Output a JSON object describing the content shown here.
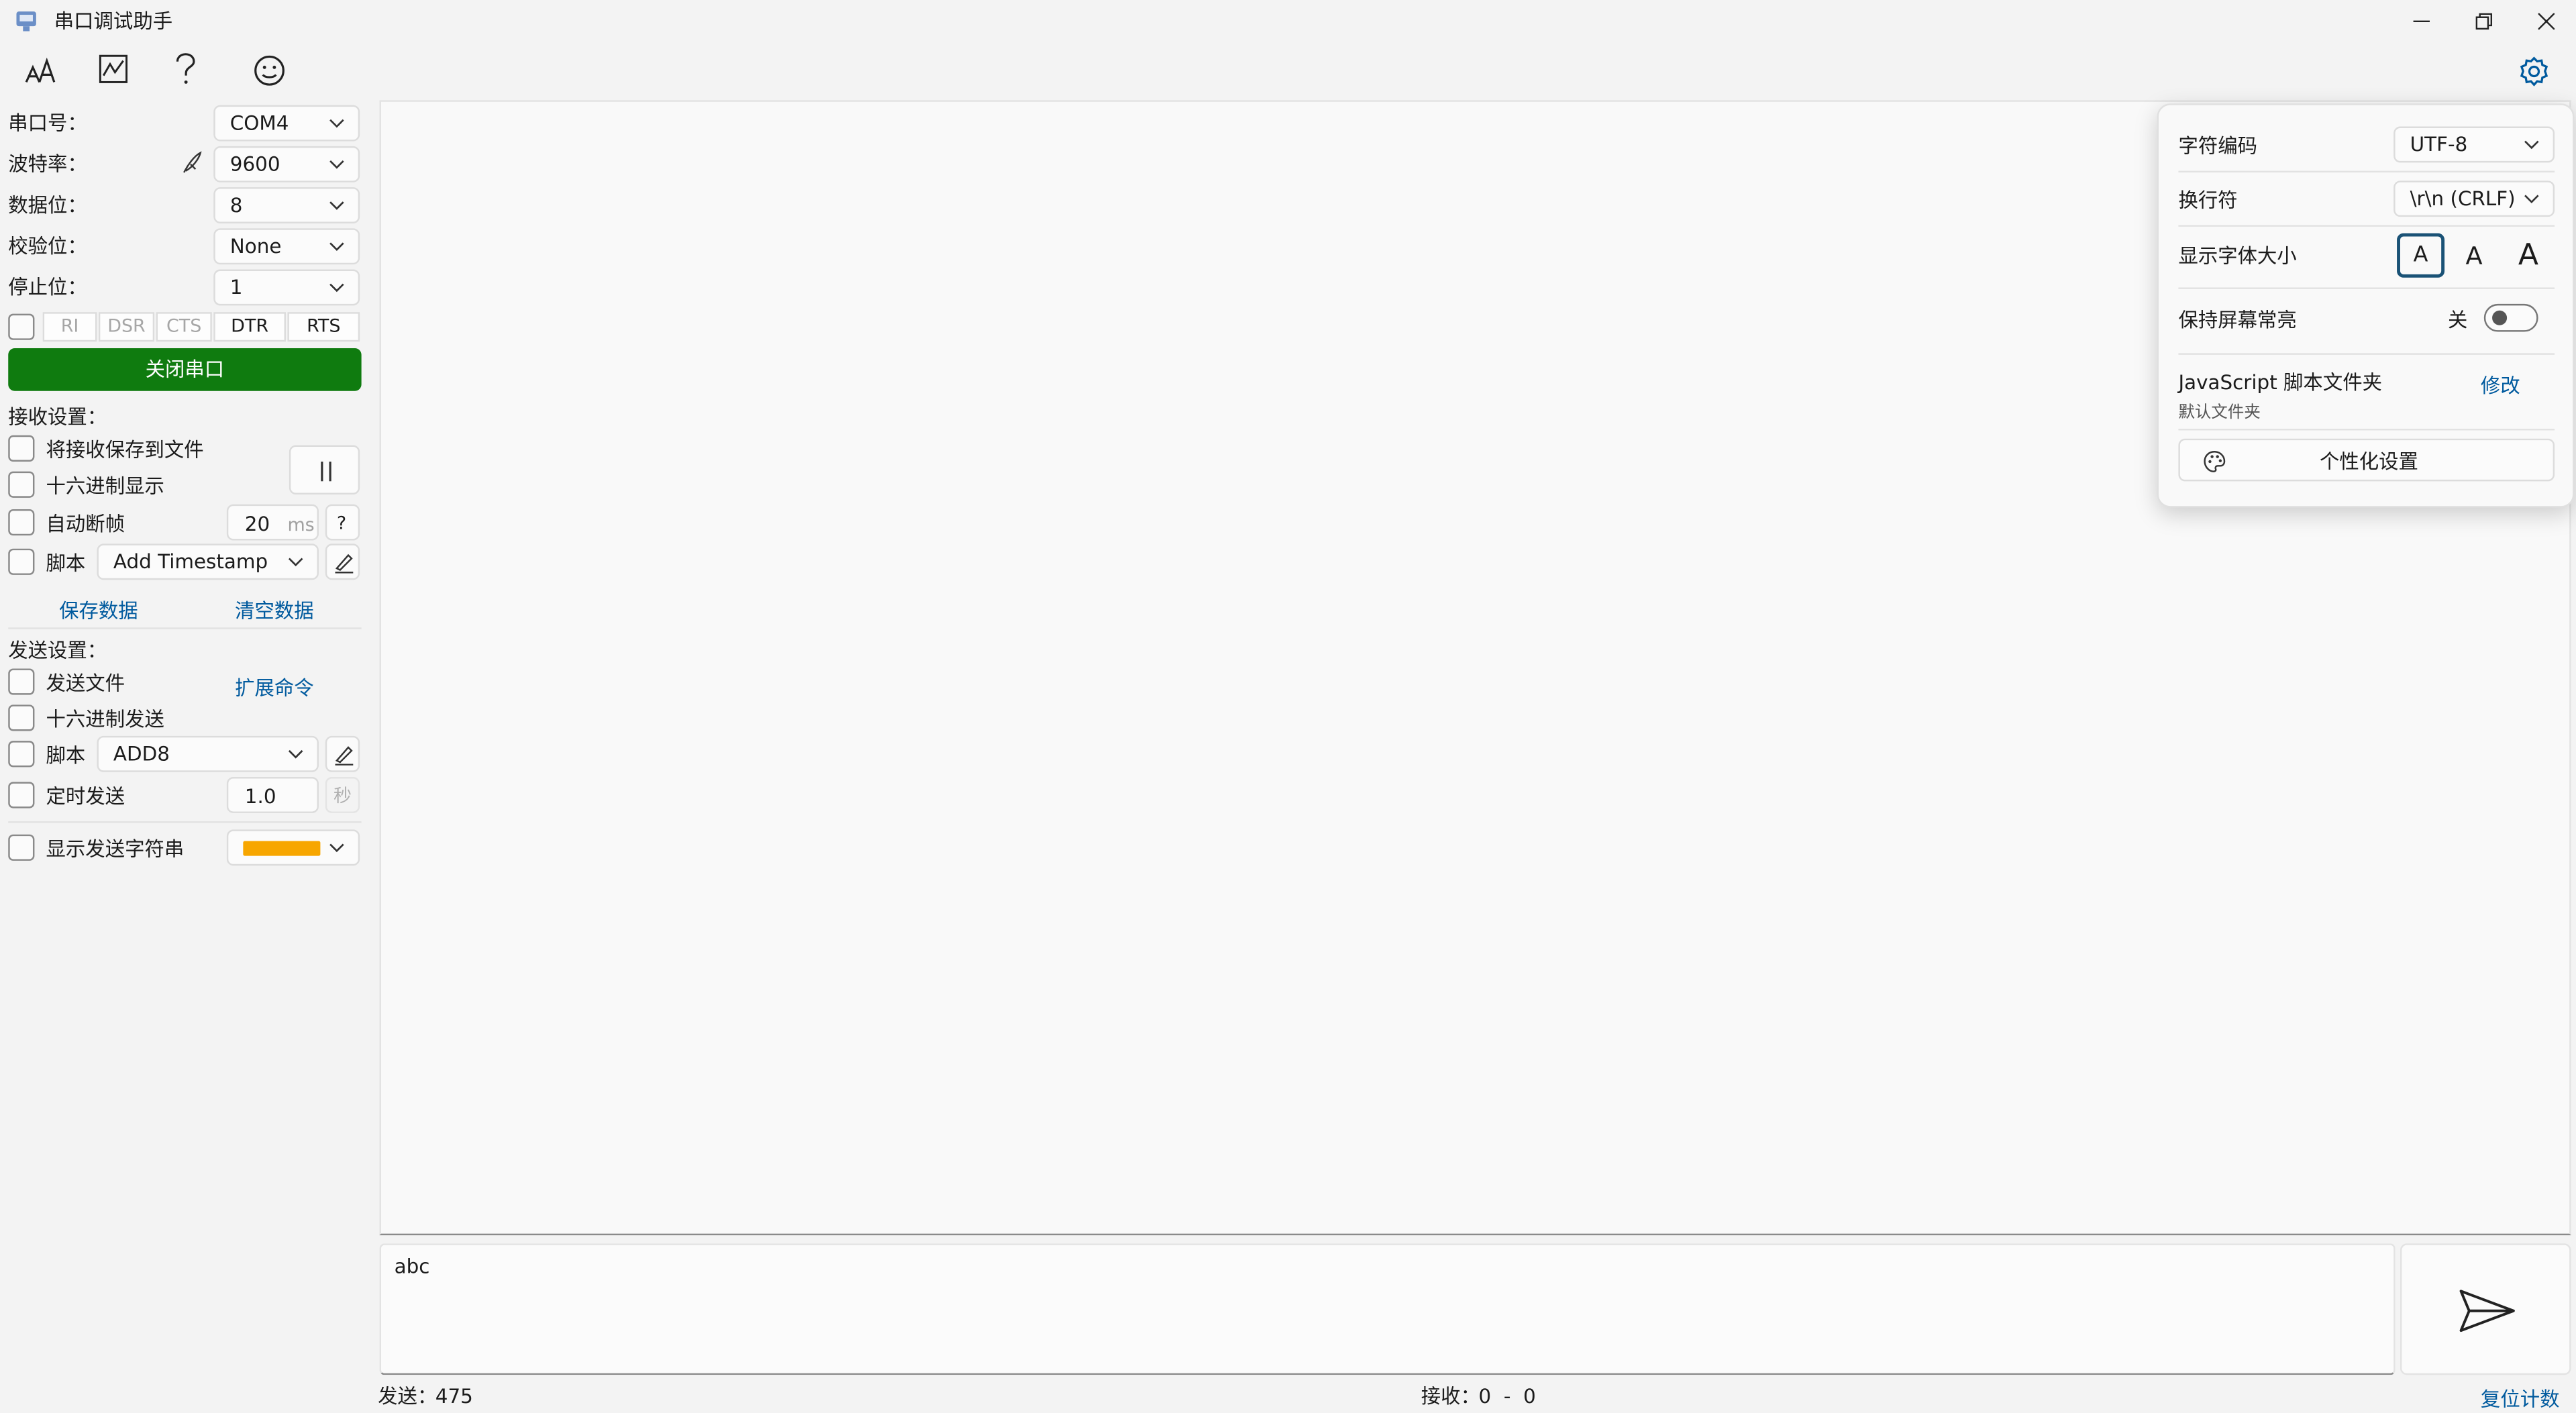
{
  "window": {
    "title": "串口调试助手",
    "icons": [
      "app-icon",
      "minimize-icon",
      "restore-icon",
      "close-icon"
    ]
  },
  "toolbar": {
    "icons": [
      "font-icon",
      "chart-icon",
      "help-icon",
      "emoji-icon",
      "settings-gear-icon"
    ]
  },
  "port": {
    "port_label": "串口号：",
    "port_value": "COM4",
    "baud_label": "波特率：",
    "baud_value": "9600",
    "data_label": "数据位：",
    "data_value": "8",
    "parity_label": "校验位：",
    "parity_value": "None",
    "stop_label": "停止位：",
    "stop_value": "1",
    "pins": {
      "ri": "RI",
      "dsr": "DSR",
      "cts": "CTS",
      "dtr": "DTR",
      "rts": "RTS"
    },
    "close_button": "关闭串口",
    "accent_color": "#0f7b0f"
  },
  "receive": {
    "title": "接收设置：",
    "save_to_file": "将接收保存到文件",
    "hex_display": "十六进制显示",
    "pause_icon": "pause-icon",
    "auto_frame": "自动断帧",
    "frame_value": "20",
    "frame_unit": "ms",
    "frame_help": "?",
    "script_label": "脚本",
    "script_value": "Add Timestamp",
    "save_data": "保存数据",
    "clear_data": "清空数据"
  },
  "send": {
    "title": "发送设置：",
    "send_file": "发送文件",
    "extend_cmd": "扩展命令",
    "hex_send": "十六进制发送",
    "script_label": "脚本",
    "script_value": "ADD8",
    "timed_send": "定时发送",
    "timed_value": "1.0",
    "timed_unit": "秒",
    "show_send_string": "显示发送字符串",
    "send_string_color": "#f7a600"
  },
  "input": {
    "value": "abc",
    "send_icon": "send-icon"
  },
  "status": {
    "sent_label": "发送：",
    "sent_value": "475",
    "recv_label": "接收：",
    "recv_value": "0  -  0",
    "reset_count": "复位计数"
  },
  "settings_panel": {
    "encoding_label": "字符编码",
    "encoding_value": "UTF-8",
    "newline_label": "换行符",
    "newline_value": "\\r\\n (CRLF)",
    "font_size_label": "显示字体大小",
    "font_sizes": [
      "A",
      "A",
      "A"
    ],
    "screen_on_label": "保持屏幕常亮",
    "screen_on_state": "关",
    "js_folder_label": "JavaScript 脚本文件夹",
    "js_folder_modify": "修改",
    "js_folder_value": "默认文件夹",
    "personalize_button": "个性化设置",
    "palette_icon": "palette-icon"
  }
}
